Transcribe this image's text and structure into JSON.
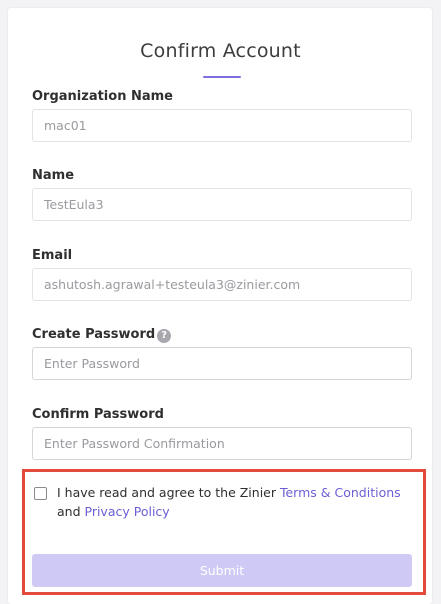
{
  "page": {
    "title": "Confirm Account",
    "accent_color": "#7b6fe0"
  },
  "form": {
    "organization": {
      "label": "Organization Name",
      "value": "mac01"
    },
    "name": {
      "label": "Name",
      "value": "TestEula3"
    },
    "email": {
      "label": "Email",
      "value": "ashutosh.agrawal+testeula3@zinier.com"
    },
    "create_password": {
      "label": "Create Password",
      "placeholder": "Enter Password",
      "help_icon": "?"
    },
    "confirm_password": {
      "label": "Confirm Password",
      "placeholder": "Enter Password Confirmation"
    }
  },
  "agreement": {
    "checked": false,
    "text_before": "I have read and agree to the Zinier ",
    "terms_link": "Terms & Conditions",
    "text_mid": " and ",
    "privacy_link": "Privacy Policy"
  },
  "submit": {
    "label": "Submit",
    "background": "#cfcaf5"
  },
  "highlight_color": "#e24b3b"
}
